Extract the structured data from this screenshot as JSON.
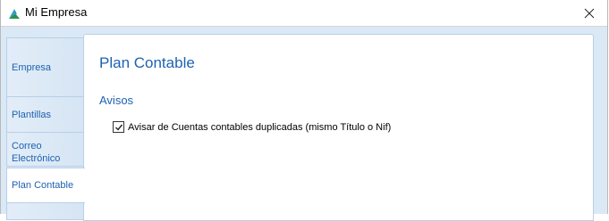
{
  "window": {
    "title": "Mi Empresa"
  },
  "sidebar": {
    "tabs": [
      {
        "label": "Empresa",
        "active": false
      },
      {
        "label": "Plantillas",
        "active": false
      },
      {
        "label": "Correo Electrónico",
        "active": false
      },
      {
        "label": "Plan Contable",
        "active": true
      }
    ]
  },
  "panel": {
    "title": "Plan Contable",
    "section": "Avisos",
    "option": {
      "label": "Avisar de Cuentas contables duplicadas (mismo Título o Nif)",
      "checked": true
    }
  },
  "icons": {
    "app": "app-logo-icon",
    "close": "close-icon",
    "check": "checkmark-icon"
  },
  "colors": {
    "accent": "#1e62b0",
    "client_background": "#dbe8f5",
    "tab_border": "#b8cfe7"
  }
}
